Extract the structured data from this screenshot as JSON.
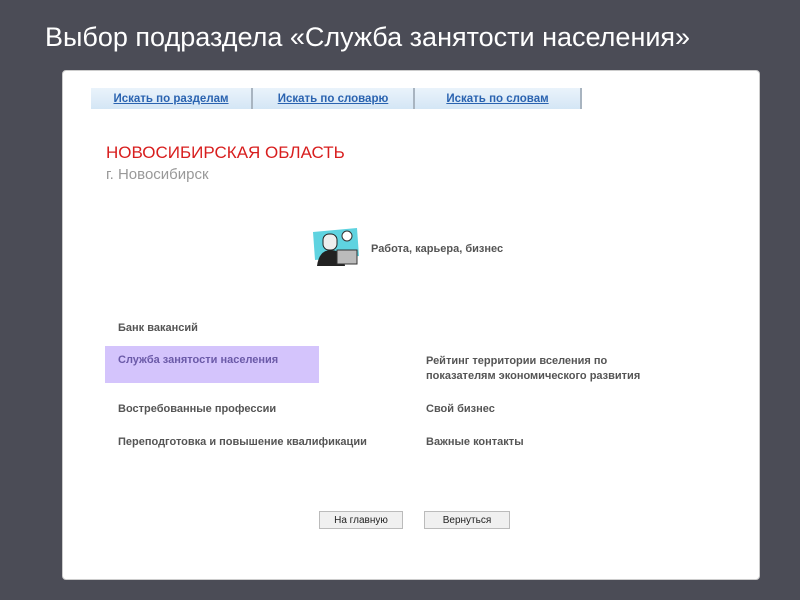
{
  "slide": {
    "title": "Выбор подраздела «Служба занятости населения»"
  },
  "tabs": [
    "Искать по разделам",
    "Искать по словарю",
    "Искать по словам"
  ],
  "region": "НОВОСИБИРСКАЯ ОБЛАСТЬ",
  "city": "г. Новосибирск",
  "category": {
    "label": "Работа, карьера, бизнес",
    "icon": "businessman-laptop-icon"
  },
  "items": {
    "bank": "Банк вакансий",
    "service": "Служба занятости населения",
    "rating": "Рейтинг территории вселения по",
    "rating2": "показателям экономического развития",
    "professions": "Востребованные профессии",
    "business": "Свой бизнес",
    "retraining": "Переподготовка и повышение квалификации",
    "contacts": "Важные контакты"
  },
  "buttons": {
    "home": "На главную",
    "back": "Вернуться"
  },
  "colors": {
    "highlight": "#d4c4fc",
    "region": "#d81e1e",
    "link": "#2a63b0"
  }
}
